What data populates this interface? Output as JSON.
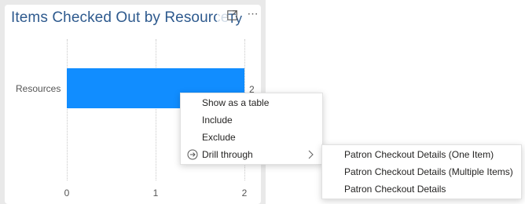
{
  "visual": {
    "title": "Items Checked Out by Resource Type",
    "title_visible": "Items Checked Out by Resource ",
    "title_cut_glyph": "Ty",
    "icons": [
      "focus-mode-icon",
      "more-options-icon"
    ],
    "more_glyph": "⋯"
  },
  "chart_data": {
    "type": "bar",
    "orientation": "horizontal",
    "categories": [
      "Resources"
    ],
    "values": [
      2
    ],
    "data_labels": [
      "2"
    ],
    "x_ticks": [
      "0",
      "1",
      "2"
    ],
    "xlim": [
      0,
      2
    ],
    "bar_color": "#118dff",
    "title": "Items Checked Out by Resource Type",
    "xlabel": "",
    "ylabel": "",
    "grid": true
  },
  "context_menu": {
    "items": [
      {
        "label": "Show as a table"
      },
      {
        "label": "Include"
      },
      {
        "label": "Exclude"
      },
      {
        "label": "Drill through",
        "icon": "drill-through-icon",
        "has_submenu": true
      }
    ]
  },
  "drill_through_submenu": {
    "items": [
      {
        "label": "Patron Checkout Details (One Item)"
      },
      {
        "label": "Patron Checkout Details (Multiple Items)"
      },
      {
        "label": "Patron Checkout Details"
      }
    ]
  },
  "colors": {
    "title": "#2e5a8e",
    "canvas_bg": "#e9e9e9",
    "bar": "#118dff"
  }
}
